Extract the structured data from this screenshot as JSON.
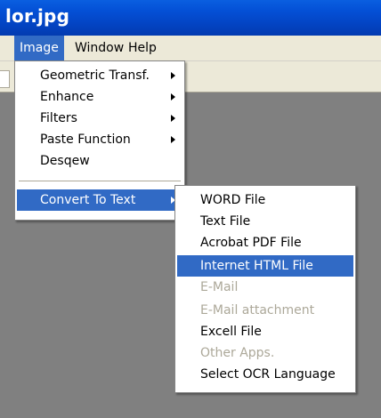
{
  "window": {
    "title": "lor.jpg"
  },
  "menubar": {
    "items": [
      {
        "label": "Image",
        "active": true
      },
      {
        "label": "Window"
      },
      {
        "label": "Help"
      }
    ]
  },
  "image_menu": {
    "items": [
      {
        "label": "Geometric Transf.",
        "submenu": true
      },
      {
        "label": "Enhance",
        "submenu": true
      },
      {
        "label": "Filters",
        "submenu": true
      },
      {
        "label": "Paste Function",
        "submenu": true
      },
      {
        "label": "Desqew",
        "submenu": false
      },
      {
        "label": "Convert To Text",
        "submenu": true,
        "highlighted": true
      }
    ]
  },
  "convert_menu": {
    "items": [
      {
        "label": "WORD File",
        "enabled": true
      },
      {
        "label": "Text File",
        "enabled": true
      },
      {
        "label": "Acrobat PDF File",
        "enabled": true
      },
      {
        "label": "Internet HTML File",
        "enabled": true,
        "highlighted": true
      },
      {
        "label": "E-Mail",
        "enabled": false
      },
      {
        "label": "E-Mail attachment",
        "enabled": false
      },
      {
        "label": "Excell File",
        "enabled": true
      },
      {
        "label": "Other Apps.",
        "enabled": false
      },
      {
        "label": "Select OCR Language",
        "enabled": true
      }
    ]
  },
  "colors": {
    "titlebar": "#0450d6",
    "menu_highlight": "#316ac5",
    "workspace": "#808080",
    "disabled_text": "#aca899"
  }
}
